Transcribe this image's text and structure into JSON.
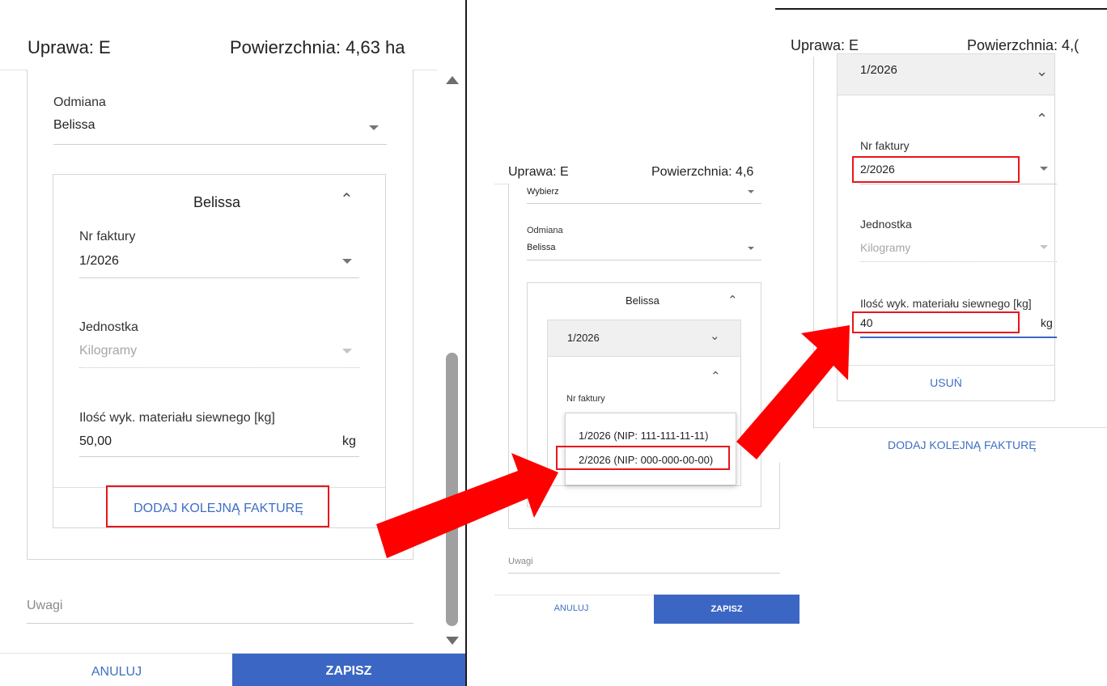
{
  "panel1": {
    "header_crop": "Uprawa: E",
    "header_area": "Powierzchnia: 4,63 ha",
    "odmiana_label": "Odmiana",
    "odmiana_value": "Belissa",
    "card_title": "Belissa",
    "nr_faktury_label": "Nr faktury",
    "nr_faktury_value": "1/2026",
    "jednostka_label": "Jednostka",
    "jednostka_value": "Kilogramy",
    "ilosc_label": "Ilość wyk. materiału siewnego [kg]",
    "ilosc_value": "50,00",
    "ilosc_unit": "kg",
    "add_invoice": "DODAJ KOLEJNĄ FAKTURĘ",
    "uwagi_placeholder": "Uwagi",
    "cancel": "ANULUJ",
    "save": "ZAPISZ"
  },
  "panel2": {
    "header_crop": "Uprawa: E",
    "header_area": "Powierzchnia: 4,6",
    "wybierz": "Wybierz",
    "odmiana_label": "Odmiana",
    "odmiana_value": "Belissa",
    "card_title": "Belissa",
    "collapsed_invoice": "1/2026",
    "nr_faktury_label": "Nr faktury",
    "options": [
      "1/2026 (NIP: 111-111-11-11)",
      "2/2026 (NIP: 000-000-00-00)"
    ],
    "uwagi_placeholder": "Uwagi",
    "cancel": "ANULUJ",
    "save": "ZAPISZ"
  },
  "panel3": {
    "header_crop": "Uprawa: E",
    "header_area": "Powierzchnia: 4,(",
    "collapsed_invoice": "1/2026",
    "nr_faktury_label": "Nr faktury",
    "nr_faktury_value": "2/2026",
    "jednostka_label": "Jednostka",
    "jednostka_value": "Kilogramy",
    "ilosc_label": "Ilość wyk. materiału siewnego [kg]",
    "ilosc_value": "40",
    "ilosc_unit": "kg",
    "remove": "USUŃ",
    "add_invoice": "DODAJ KOLEJNĄ FAKTURĘ"
  },
  "icons": {
    "dropdown": "caret-down-icon",
    "expand": "chevron-up-icon",
    "collapse": "chevron-down-icon",
    "annotation": "red-arrow-icon"
  },
  "colors": {
    "accent": "#3b66c4",
    "link": "#3f6fc4",
    "highlight": "#e8151d",
    "scrollbar": "#a0a0a0"
  }
}
